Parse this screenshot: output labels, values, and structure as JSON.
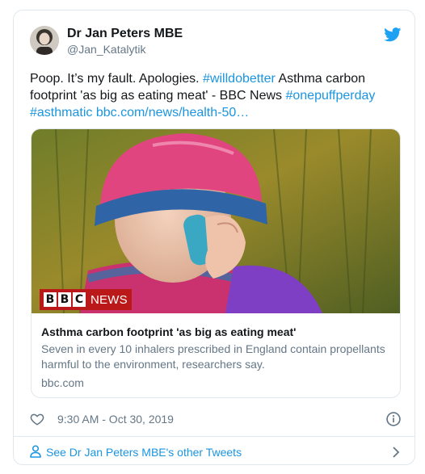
{
  "tweet": {
    "author_name": "Dr Jan Peters MBE",
    "author_handle": "@Jan_Katalytik",
    "text_parts": [
      {
        "type": "text",
        "value": "Poop. It’s my fault. Apologies. "
      },
      {
        "type": "link",
        "value": "#willdobetter"
      },
      {
        "type": "text",
        "value": " Asthma carbon footprint 'as big as eating meat' - BBC News "
      },
      {
        "type": "link",
        "value": "#onepuffperday"
      },
      {
        "type": "text",
        "value": " "
      },
      {
        "type": "link",
        "value": "#asthmatic"
      },
      {
        "type": "text",
        "value": " "
      },
      {
        "type": "link",
        "value": "bbc.com/news/health-50…"
      }
    ],
    "timestamp": "9:30 AM - Oct 30, 2019"
  },
  "card": {
    "badge_letters": [
      "B",
      "B",
      "C"
    ],
    "badge_label": "NEWS",
    "title": "Asthma carbon footprint 'as big as eating meat'",
    "description": "Seven in every 10 inhalers prescribed in England contain propellants harmful to the environment, researchers say.",
    "domain": "bbc.com"
  },
  "footer": {
    "link_text": "See Dr Jan Peters MBE's other Tweets"
  },
  "colors": {
    "link": "#1b95e0",
    "secondary_text": "#657786",
    "border": "#e1e8ed",
    "bbc_red": "#bb1919"
  },
  "icons": [
    "twitter-bird-icon",
    "heart-icon",
    "info-icon",
    "person-icon",
    "chevron-right-icon"
  ]
}
